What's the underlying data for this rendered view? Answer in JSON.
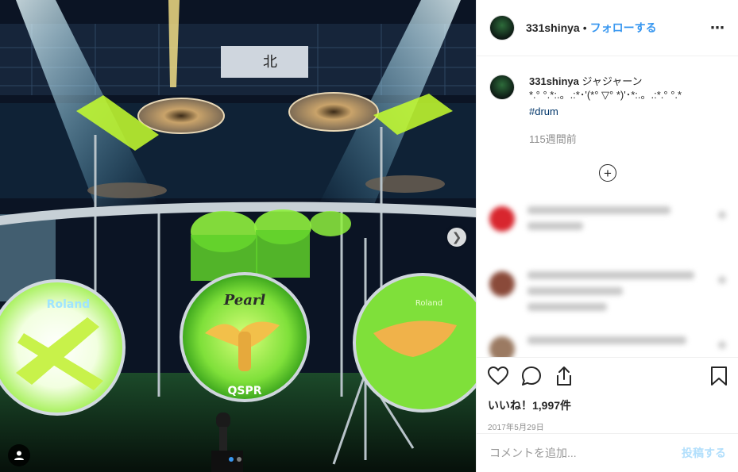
{
  "post": {
    "username": "331shinya",
    "separator": "•",
    "follow_label": "フォローする",
    "more_icon": "more-horizontal-icon",
    "caption_text": "ジャジャーン\n*.° °.*:.。.:*･'(*° ▽° *)'･*:.。.:*.° °.*",
    "hashtag": "#drum",
    "caption_time": "115週間前",
    "likes_text": "いいね！1,997件",
    "date_text": "2017年5月29日"
  },
  "photo": {
    "drum_brand": "Pearl",
    "drum_text": "QSPR",
    "left_drum_text": "Roland",
    "right_drum_text": "Roland",
    "banner_text": "北"
  },
  "comment_form": {
    "placeholder": "コメントを追加...",
    "post_label": "投稿する"
  },
  "icons": {
    "like": "heart-icon",
    "comment": "comment-icon",
    "share": "share-icon",
    "save": "bookmark-icon",
    "load_more": "plus-circle-icon",
    "next": "chevron-right-icon",
    "tag": "user-icon"
  },
  "colors": {
    "link_blue": "#3897f0",
    "hashtag": "#003569",
    "muted": "#8e8e8e",
    "post_disabled": "#b2dffc"
  }
}
